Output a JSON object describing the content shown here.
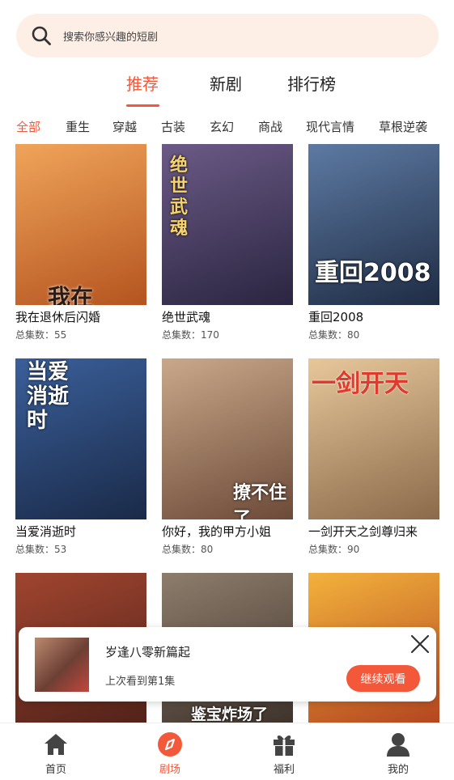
{
  "search": {
    "placeholder": "搜索你感兴趣的短剧"
  },
  "tabs": [
    {
      "label": "推荐",
      "active": true
    },
    {
      "label": "新剧",
      "active": false
    },
    {
      "label": "排行榜",
      "active": false
    }
  ],
  "categories": [
    {
      "label": "全部",
      "active": true
    },
    {
      "label": "重生"
    },
    {
      "label": "穿越"
    },
    {
      "label": "古装"
    },
    {
      "label": "玄幻"
    },
    {
      "label": "商战"
    },
    {
      "label": "现代言情"
    },
    {
      "label": "草根逆袭"
    }
  ],
  "dramas": [
    {
      "title": "我在退休后闪婚",
      "count": "总集数：55",
      "poster_text": "我在",
      "colors": [
        "#f0a45a",
        "#b4541f"
      ]
    },
    {
      "title": "绝世武魂",
      "count": "总集数：170",
      "poster_text": "绝世武魂",
      "colors": [
        "#6b5a86",
        "#2a2540"
      ]
    },
    {
      "title": "重回2008",
      "count": "总集数：80",
      "poster_text": "重回2008",
      "colors": [
        "#5d7aa3",
        "#1f2c44"
      ]
    },
    {
      "title": "当爱消逝时",
      "count": "总集数：53",
      "poster_text": "当爱消逝时",
      "colors": [
        "#3a5f9a",
        "#1a2a48"
      ]
    },
    {
      "title": "你好，我的甲方小姐",
      "count": "总集数：80",
      "poster_text": "撩不住了",
      "colors": [
        "#c9a88a",
        "#6c4a38"
      ]
    },
    {
      "title": "一剑开天之剑尊归来",
      "count": "总集数：90",
      "poster_text": "一剑开天",
      "colors": [
        "#e7c79a",
        "#8a6a4a"
      ]
    },
    {
      "title": "",
      "count": "",
      "poster_text": "",
      "colors": [
        "#a0452f",
        "#4e2018"
      ]
    },
    {
      "title": "",
      "count": "",
      "poster_text": "鉴宝炸场了",
      "colors": [
        "#8e7d6c",
        "#3a2f28"
      ]
    },
    {
      "title": "",
      "count": "",
      "poster_text": "",
      "colors": [
        "#f3b23c",
        "#b0401e"
      ]
    }
  ],
  "continue_watching": {
    "title": "岁逢八零新篇起",
    "subtitle": "上次看到第1集",
    "button": "继续观看"
  },
  "nav": [
    {
      "label": "首页",
      "icon": "home-icon",
      "active": false
    },
    {
      "label": "剧场",
      "icon": "compass-icon",
      "active": true
    },
    {
      "label": "福利",
      "icon": "gift-icon",
      "active": false
    },
    {
      "label": "我的",
      "icon": "user-icon",
      "active": false
    }
  ],
  "colors": {
    "accent": "#f4583a",
    "search_bg": "#fdeee6"
  }
}
